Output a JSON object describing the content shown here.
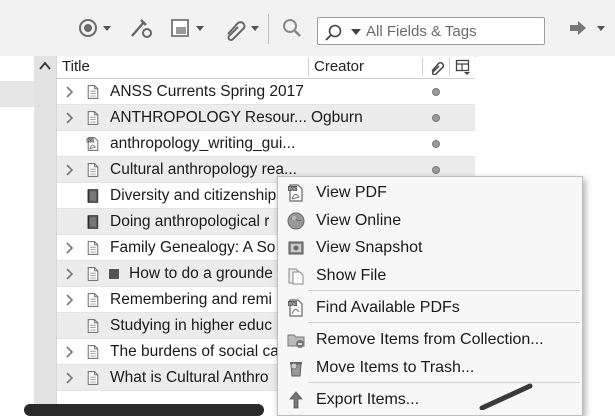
{
  "toolbar": {
    "search_placeholder": "All Fields & Tags",
    "icons": [
      "new-item-icon",
      "add-by-identifier-icon",
      "new-note-icon",
      "attachment-icon",
      "locate-icon",
      "search-mode-icon",
      "sync-icon"
    ]
  },
  "columns": {
    "title": "Title",
    "creator": "Creator"
  },
  "rows": [
    {
      "title": "ANSS Currents Spring 2017",
      "creator": "",
      "icon": "document-icon",
      "twisty": true,
      "dot": true
    },
    {
      "title": "ANTHROPOLOGY Resour...",
      "creator": "Ogburn",
      "icon": "document-icon",
      "twisty": true,
      "dot": true
    },
    {
      "title": "anthropology_writing_gui...",
      "creator": "",
      "icon": "pdf-icon",
      "twisty": false,
      "dot": true
    },
    {
      "title": "Cultural anthropology rea...",
      "creator": "",
      "icon": "document-icon",
      "twisty": true,
      "dot": true
    },
    {
      "title": "Diversity and citizenship",
      "creator": "",
      "icon": "book-icon",
      "twisty": false,
      "dot": false
    },
    {
      "title": "Doing anthropological r",
      "creator": "",
      "icon": "book-icon",
      "twisty": false,
      "dot": false
    },
    {
      "title": "Family Genealogy: A So",
      "creator": "",
      "icon": "document-icon",
      "twisty": true,
      "dot": false
    },
    {
      "title": "How to do a grounde",
      "creator": "",
      "icon": "document-icon",
      "twisty": true,
      "dot": false
    },
    {
      "title": "Remembering and remi",
      "creator": "",
      "icon": "document-icon",
      "twisty": true,
      "dot": false
    },
    {
      "title": "Studying in higher educ",
      "creator": "",
      "icon": "document-icon",
      "twisty": false,
      "dot": false
    },
    {
      "title": "The burdens of social ca",
      "creator": "",
      "icon": "document-icon",
      "twisty": true,
      "dot": false
    },
    {
      "title": "What is Cultural Anthro",
      "creator": "",
      "icon": "document-icon",
      "twisty": true,
      "dot": false
    }
  ],
  "context_menu": {
    "items": [
      {
        "label": "View PDF",
        "icon": "pdf-icon"
      },
      {
        "label": "View Online",
        "icon": "globe-icon"
      },
      {
        "label": "View Snapshot",
        "icon": "snapshot-icon"
      },
      {
        "label": "Show File",
        "icon": "file-icon"
      },
      {
        "label": "Find Available PDFs",
        "icon": "find-pdf-icon"
      },
      {
        "label": "Remove Items from Collection...",
        "icon": "remove-from-collection-icon"
      },
      {
        "label": "Move Items to Trash...",
        "icon": "trash-icon"
      },
      {
        "label": "Export Items...",
        "icon": "export-icon"
      }
    ]
  }
}
